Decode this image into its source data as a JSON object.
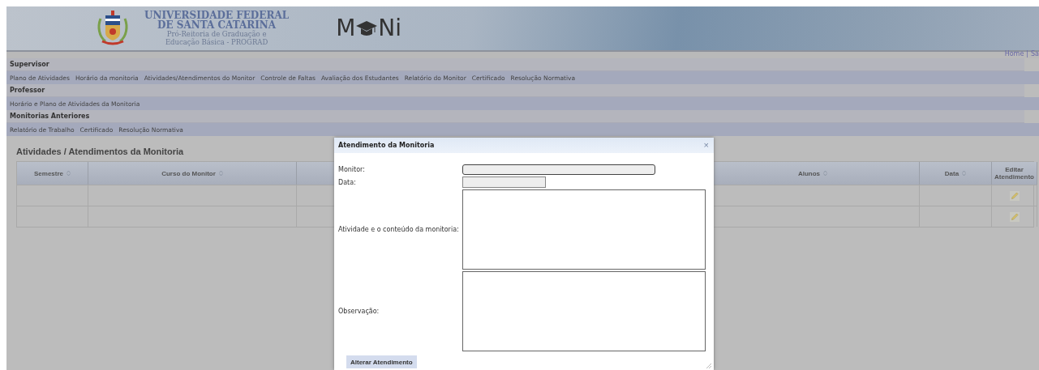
{
  "header": {
    "university": [
      "UNIVERSIDADE FEDERAL",
      "DE SANTA CATARINA"
    ],
    "subtitle": [
      "Pró-Reitoria de Graduação e",
      "Educação Básica - PROGRAD"
    ],
    "logo": {
      "before": "M",
      "after": "Ni"
    }
  },
  "top_links": [
    "Home",
    "|",
    "Sa"
  ],
  "menu_sections": [
    {
      "title": "Supervisor",
      "links": [
        "Plano de Atividades",
        "Horário da monitoria",
        "Atividades/Atendimentos do Monitor",
        "Controle de Faltas",
        "Avaliação dos Estudantes",
        "Relatório do Monitor",
        "Certificado",
        "Resolução Normativa"
      ]
    },
    {
      "title": "Professor",
      "links": [
        "Horário e Plano de Atividades da Monitoria"
      ]
    },
    {
      "title": "Monitorias Anteriores",
      "links": [
        "Relatório de Trabalho",
        "Certificado",
        "Resolução Normativa"
      ]
    }
  ],
  "page_title": "Atividades / Atendimentos da Monitoria",
  "table": {
    "columns": [
      {
        "kind": "sortable",
        "label": "Semestre"
      },
      {
        "kind": "sortable",
        "label": "Curso do Monitor"
      },
      {
        "kind": "hidden"
      },
      {
        "kind": "sortable",
        "label": "Alunos"
      },
      {
        "kind": "sortable",
        "label": "Data"
      },
      {
        "kind": "plain",
        "label": "Editar Atendimento"
      }
    ],
    "rows": [
      {
        "editable": true
      },
      {
        "editable": true
      }
    ]
  },
  "dialog": {
    "title": "Atendimento da Monitoria",
    "close": "×",
    "fields": [
      {
        "kind": "input",
        "label": "Monitor:",
        "wide": true
      },
      {
        "kind": "input",
        "label": "Data:",
        "wide": false
      },
      {
        "kind": "textarea",
        "label": "Atividade e o conteúdo da monitoria:"
      },
      {
        "kind": "textarea",
        "label": "Observação:"
      }
    ],
    "button": "Alterar Atendimento"
  }
}
